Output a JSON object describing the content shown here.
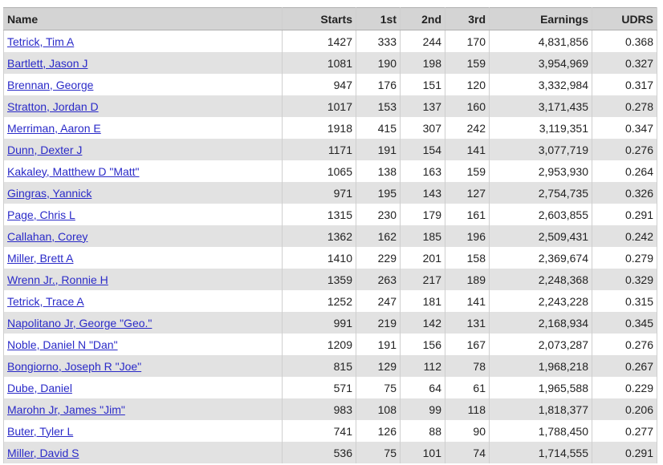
{
  "table": {
    "headers": [
      "Name",
      "Starts",
      "1st",
      "2nd",
      "3rd",
      "Earnings",
      "UDRS"
    ],
    "rows": [
      {
        "name": "Tetrick, Tim A",
        "starts": "1427",
        "first": "333",
        "second": "244",
        "third": "170",
        "earnings": "4,831,856",
        "udrs": "0.368"
      },
      {
        "name": "Bartlett, Jason J",
        "starts": "1081",
        "first": "190",
        "second": "198",
        "third": "159",
        "earnings": "3,954,969",
        "udrs": "0.327"
      },
      {
        "name": "Brennan, George",
        "starts": "947",
        "first": "176",
        "second": "151",
        "third": "120",
        "earnings": "3,332,984",
        "udrs": "0.317"
      },
      {
        "name": "Stratton, Jordan D",
        "starts": "1017",
        "first": "153",
        "second": "137",
        "third": "160",
        "earnings": "3,171,435",
        "udrs": "0.278"
      },
      {
        "name": "Merriman, Aaron E",
        "starts": "1918",
        "first": "415",
        "second": "307",
        "third": "242",
        "earnings": "3,119,351",
        "udrs": "0.347"
      },
      {
        "name": "Dunn, Dexter J",
        "starts": "1171",
        "first": "191",
        "second": "154",
        "third": "141",
        "earnings": "3,077,719",
        "udrs": "0.276"
      },
      {
        "name": "Kakaley, Matthew D \"Matt\"",
        "starts": "1065",
        "first": "138",
        "second": "163",
        "third": "159",
        "earnings": "2,953,930",
        "udrs": "0.264"
      },
      {
        "name": "Gingras, Yannick",
        "starts": "971",
        "first": "195",
        "second": "143",
        "third": "127",
        "earnings": "2,754,735",
        "udrs": "0.326"
      },
      {
        "name": "Page, Chris L",
        "starts": "1315",
        "first": "230",
        "second": "179",
        "third": "161",
        "earnings": "2,603,855",
        "udrs": "0.291"
      },
      {
        "name": "Callahan, Corey",
        "starts": "1362",
        "first": "162",
        "second": "185",
        "third": "196",
        "earnings": "2,509,431",
        "udrs": "0.242"
      },
      {
        "name": "Miller, Brett A",
        "starts": "1410",
        "first": "229",
        "second": "201",
        "third": "158",
        "earnings": "2,369,674",
        "udrs": "0.279"
      },
      {
        "name": "Wrenn Jr., Ronnie H",
        "starts": "1359",
        "first": "263",
        "second": "217",
        "third": "189",
        "earnings": "2,248,368",
        "udrs": "0.329"
      },
      {
        "name": "Tetrick, Trace A",
        "starts": "1252",
        "first": "247",
        "second": "181",
        "third": "141",
        "earnings": "2,243,228",
        "udrs": "0.315"
      },
      {
        "name": "Napolitano Jr, George \"Geo.\"",
        "starts": "991",
        "first": "219",
        "second": "142",
        "third": "131",
        "earnings": "2,168,934",
        "udrs": "0.345"
      },
      {
        "name": "Noble, Daniel N \"Dan\"",
        "starts": "1209",
        "first": "191",
        "second": "156",
        "third": "167",
        "earnings": "2,073,287",
        "udrs": "0.276"
      },
      {
        "name": "Bongiorno, Joseph R \"Joe\"",
        "starts": "815",
        "first": "129",
        "second": "112",
        "third": "78",
        "earnings": "1,968,218",
        "udrs": "0.267"
      },
      {
        "name": "Dube, Daniel",
        "starts": "571",
        "first": "75",
        "second": "64",
        "third": "61",
        "earnings": "1,965,588",
        "udrs": "0.229"
      },
      {
        "name": "Marohn Jr, James \"Jim\"",
        "starts": "983",
        "first": "108",
        "second": "99",
        "third": "118",
        "earnings": "1,818,377",
        "udrs": "0.206"
      },
      {
        "name": "Buter, Tyler L",
        "starts": "741",
        "first": "126",
        "second": "88",
        "third": "90",
        "earnings": "1,788,450",
        "udrs": "0.277"
      },
      {
        "name": "Miller, David S",
        "starts": "536",
        "first": "75",
        "second": "101",
        "third": "74",
        "earnings": "1,714,555",
        "udrs": "0.291"
      }
    ]
  }
}
